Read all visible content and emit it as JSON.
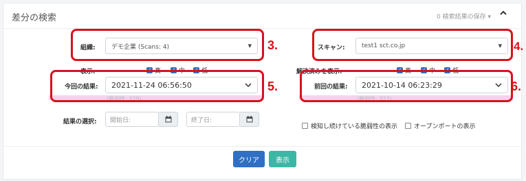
{
  "header": {
    "title": "差分の検索",
    "save_label": "0 検索結果の保存 ▾",
    "collapse_glyph": "^"
  },
  "organization": {
    "label": "組織:",
    "value": "デモ企業 (Scans: 4)",
    "callout": "3."
  },
  "scan": {
    "label": "スキャン:",
    "value": "test1 sct.co.jp",
    "callout": "4."
  },
  "display": {
    "label": "表示:",
    "options": [
      "高",
      "中",
      "低"
    ]
  },
  "resolved_display": {
    "label": "解決済みを表示:",
    "options": [
      "高",
      "中",
      "低"
    ]
  },
  "current_result": {
    "label": "今回の結果:",
    "value": "2021-11-24 06:56:50",
    "callout": "5.",
    "sub": "(脆弱性: 329)"
  },
  "previous_result": {
    "label": "前回の結果:",
    "value": "2021-10-14 06:23:29",
    "callout": "6.",
    "sub": "(脆弱性: 327)"
  },
  "result_select": {
    "label": "結果の選択:",
    "start_placeholder": "開始日:",
    "end_placeholder": "終了日:"
  },
  "options": {
    "continuing_vuln": "検知し続けている脆弱性の表示",
    "open_ports": "オープンポートの表示"
  },
  "buttons": {
    "clear": "クリア",
    "show": "表示"
  },
  "colors": {
    "callout_red": "#d8111b",
    "clear_btn": "#2f6fc4",
    "show_btn": "#3cb7a5",
    "checkbox": "#2f6fc4"
  }
}
